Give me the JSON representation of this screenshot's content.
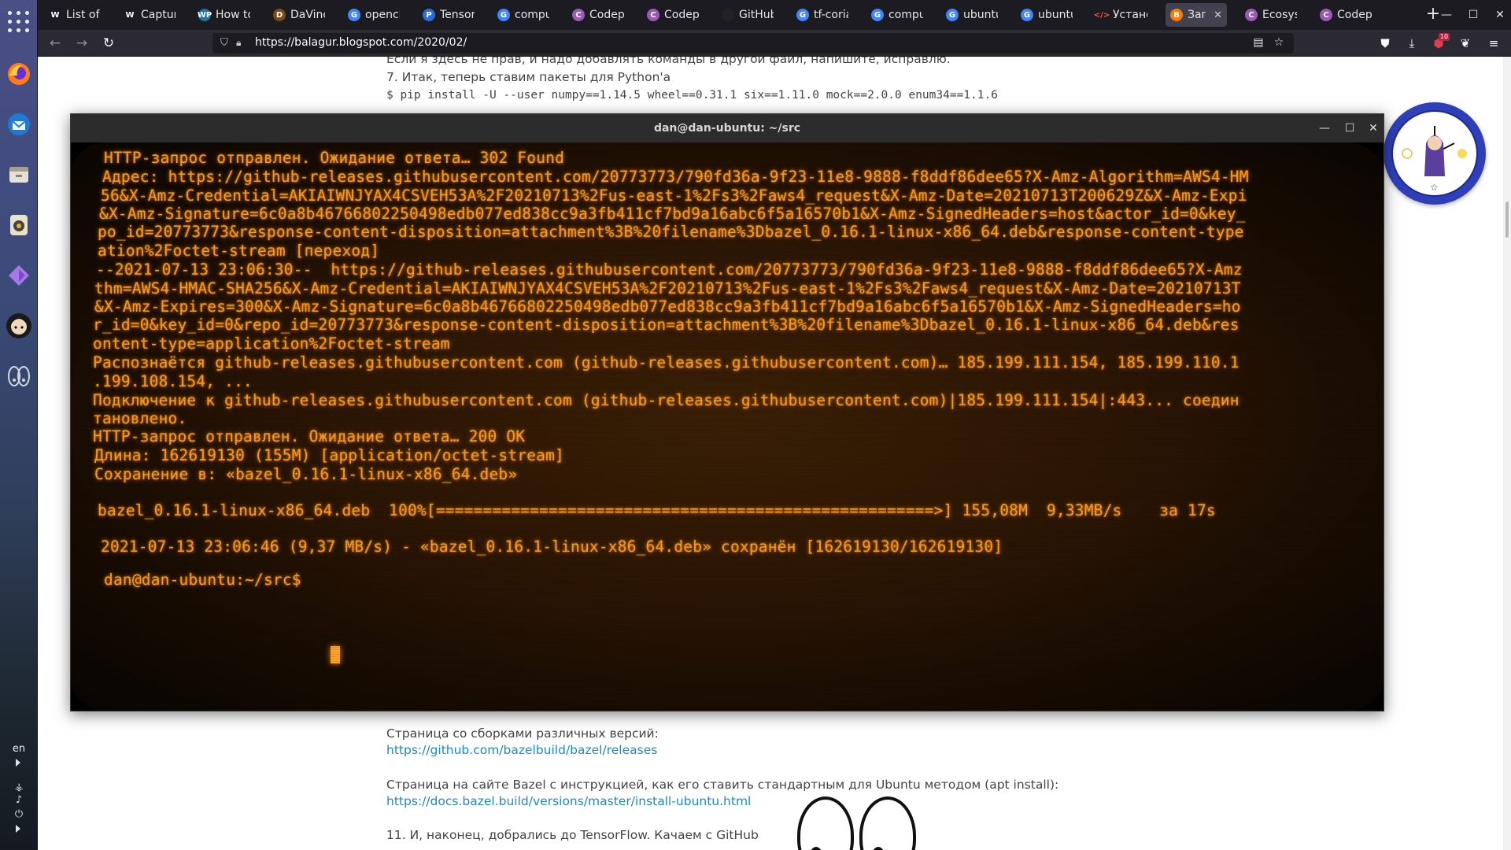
{
  "browser": {
    "tabs": [
      {
        "label": "List of C",
        "icon": "W",
        "color": "#ffffff",
        "bg": "#1c1b22"
      },
      {
        "label": "Capture",
        "icon": "W",
        "color": "#ffffff",
        "bg": "#1c1b22"
      },
      {
        "label": "How to",
        "icon": "WP",
        "color": "#ffffff",
        "bg": "#21759b"
      },
      {
        "label": "DaVinci",
        "icon": "D",
        "color": "#ffffff",
        "bg": "#7a4a1a"
      },
      {
        "label": "opencl",
        "icon": "G",
        "color": "#ffffff",
        "bg": "#4285f4"
      },
      {
        "label": "Tensor",
        "icon": "P",
        "color": "#ffffff",
        "bg": "#2a6fd6"
      },
      {
        "label": "comput",
        "icon": "G",
        "color": "#ffffff",
        "bg": "#4285f4"
      },
      {
        "label": "Codepl",
        "icon": "C",
        "color": "#ffffff",
        "bg": "#9b59b6"
      },
      {
        "label": "Codepl",
        "icon": "C",
        "color": "#ffffff",
        "bg": "#9b59b6"
      },
      {
        "label": "GitHub",
        "icon": "",
        "color": "#ffffff",
        "bg": "#222222"
      },
      {
        "label": "tf-coria",
        "icon": "G",
        "color": "#ffffff",
        "bg": "#4285f4"
      },
      {
        "label": "comput",
        "icon": "G",
        "color": "#ffffff",
        "bg": "#4285f4"
      },
      {
        "label": "ubuntu",
        "icon": "G",
        "color": "#ffffff",
        "bg": "#4285f4"
      },
      {
        "label": "ubuntu",
        "icon": "G",
        "color": "#ffffff",
        "bg": "#4285f4"
      },
      {
        "label": "Устано",
        "icon": "</>",
        "color": "#ff5555",
        "bg": "#1c1b22"
      },
      {
        "label": "Запи",
        "icon": "B",
        "color": "#ffffff",
        "bg": "#f57d00",
        "active": true
      },
      {
        "label": "Ecosyst",
        "icon": "C",
        "color": "#ffffff",
        "bg": "#9b59b6"
      },
      {
        "label": "Codepl",
        "icon": "C",
        "color": "#ffffff",
        "bg": "#9b59b6"
      }
    ],
    "url": "https://balagur.blogspot.com/2020/02/",
    "extension_badge": "10"
  },
  "page": {
    "line1": "Если я здесь не прав, и надо добавлять команды в другой файл, напишите, исправлю.",
    "line2": "7. Итак, теперь ставим пакеты для Python'a",
    "line3": "$ pip install -U --user numpy==1.14.5 wheel==0.31.1 six==1.11.0 mock==2.0.0 enum34==1.1.6",
    "releases_label": "Страница со сборками различных версий:",
    "releases_link": "https://github.com/bazelbuild/bazel/releases",
    "docs_label": "Страница на сайте Bazel с инструкцией, как его ставить стандартным для Ubuntu методом (apt install):",
    "docs_link": "https://docs.bazel.build/versions/master/install-ubuntu.html",
    "step11": "11. И, наконец, добрались до TensorFlow. Качаем с GitHub"
  },
  "terminal": {
    "title": "dan@dan-ubuntu: ~/src",
    "lines": [
      "HTTP-запрос отправлен. Ожидание ответа… 302 Found",
      "Адрес: https://github-releases.githubusercontent.com/20773773/790fd36a-9f23-11e8-9888-f8ddf86dee65?X-Amz-Algorithm=AWS4-HM",
      "56&X-Amz-Credential=AKIAIWNJYAX4CSVEH53A%2F20210713%2Fus-east-1%2Fs3%2Faws4_request&X-Amz-Date=20210713T200629Z&X-Amz-Expi",
      "&X-Amz-Signature=6c0a8b46766802250498edb077ed838cc9a3fb411cf7bd9a16abc6f5a16570b1&X-Amz-SignedHeaders=host&actor_id=0&key_",
      "po_id=20773773&response-content-disposition=attachment%3B%20filename%3Dbazel_0.16.1-linux-x86_64.deb&response-content-type",
      "ation%2Foctet-stream [переход]",
      "--2021-07-13 23:06:30--  https://github-releases.githubusercontent.com/20773773/790fd36a-9f23-11e8-9888-f8ddf86dee65?X-Amz",
      "thm=AWS4-HMAC-SHA256&X-Amz-Credential=AKIAIWNJYAX4CSVEH53A%2F20210713%2Fus-east-1%2Fs3%2Faws4_request&X-Amz-Date=20210713T",
      "&X-Amz-Expires=300&X-Amz-Signature=6c0a8b46766802250498edb077ed838cc9a3fb411cf7bd9a16abc6f5a16570b1&X-Amz-SignedHeaders=ho",
      "r_id=0&key_id=0&repo_id=20773773&response-content-disposition=attachment%3B%20filename%3Dbazel_0.16.1-linux-x86_64.deb&res",
      "ontent-type=application%2Foctet-stream",
      "Распознаётся github-releases.githubusercontent.com (github-releases.githubusercontent.com)… 185.199.111.154, 185.199.110.1",
      ".199.108.154, ...",
      "Подключение к github-releases.githubusercontent.com (github-releases.githubusercontent.com)|185.199.111.154|:443... соедин",
      "тановлено.",
      "HTTP-запрос отправлен. Ожидание ответа… 200 OK",
      "Длина: 162619130 (155M) [application/octet-stream]",
      "Сохранение в: «bazel_0.16.1-linux-x86_64.deb»",
      "bazel_0.16.1-linux-x86_64.deb  100%[=====================================================>] 155,08M  9,33MB/s    за 17s",
      "2021-07-13 23:06:46 (9,37 MB/s) - «bazel_0.16.1-linux-x86_64.deb» сохранён [162619130/162619130]",
      "dan@dan-ubuntu:~/src$ "
    ],
    "text_color": "#ff9a22"
  },
  "dock": {
    "lang": "en",
    "apps": [
      "firefox-icon",
      "thunderbird-icon",
      "files-icon",
      "rhythmbox-icon",
      "app-store-icon",
      "avatar-app-icon",
      "eyes-app-icon"
    ]
  }
}
